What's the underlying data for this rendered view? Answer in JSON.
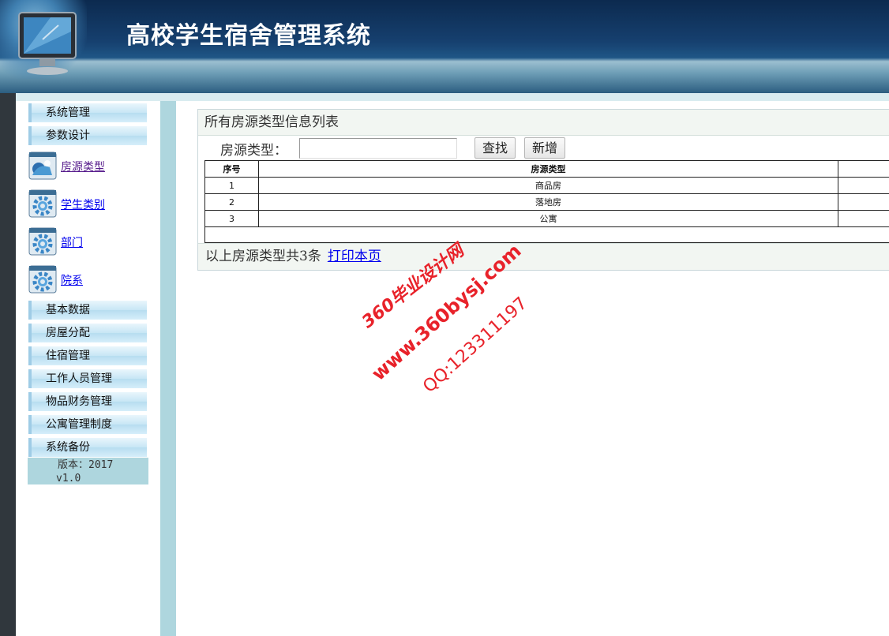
{
  "header": {
    "title": "高校学生宿舍管理系统",
    "icon": "monitor-icon"
  },
  "sidebar": {
    "top_menus": [
      {
        "label": "系统管理"
      },
      {
        "label": "参数设计"
      }
    ],
    "sub_items": [
      {
        "label": "房源类型",
        "icon": "gear-icon"
      },
      {
        "label": "学生类别",
        "icon": "gear-icon"
      },
      {
        "label": "部门",
        "icon": "gear-icon"
      },
      {
        "label": "院系",
        "icon": "gear-icon"
      }
    ],
    "bottom_menus": [
      {
        "label": "基本数据"
      },
      {
        "label": "房屋分配"
      },
      {
        "label": "住宿管理"
      },
      {
        "label": "工作人员管理"
      },
      {
        "label": "物品财务管理"
      },
      {
        "label": "公寓管理制度"
      },
      {
        "label": "系统备份"
      }
    ],
    "version_line1": "版本：2017",
    "version_line2": "v1.0"
  },
  "panel": {
    "title": "所有房源类型信息列表",
    "search_label": "房源类型：",
    "search_value": "",
    "search_button": "查找",
    "add_button": "新增",
    "table": {
      "headers": [
        "序号",
        "房源类型"
      ],
      "rows": [
        [
          "1",
          "商品房"
        ],
        [
          "2",
          "落地房"
        ],
        [
          "3",
          "公寓"
        ]
      ]
    },
    "footer_text": "以上房源类型共3条",
    "print_link": "打印本页"
  },
  "watermark": {
    "line1": "360毕业设计网",
    "line2": "www.360bysj.com",
    "line3": "QQ:123311197",
    "color": "#e8222a"
  }
}
